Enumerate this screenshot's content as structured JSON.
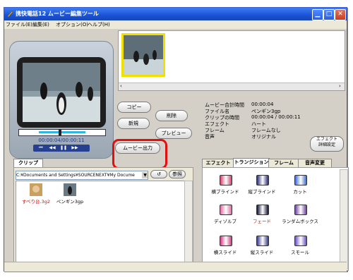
{
  "window": {
    "title": "携快電話12 ムービー編集ツール"
  },
  "menu": [
    "ファイル(E)",
    "編集(E)",
    "オプション(O)",
    "ヘルプ(H)"
  ],
  "player": {
    "time": "00:00:04/00:00:11"
  },
  "buttons": {
    "copy": "コピー",
    "delete": "削除",
    "new": "新規",
    "preview": "プレビュー",
    "movie_out": "ムービー出力",
    "effect_settings_line1": "エフェクト",
    "effect_settings_line2": "詳細設定",
    "browse": "参照"
  },
  "info": [
    {
      "label": "ムービー合計時間",
      "value": "00:00:04"
    },
    {
      "label": "ファイル名",
      "value": "ペンギン3gp"
    },
    {
      "label": "クリップの時間",
      "value": "00:00:04 / 00:00:11"
    },
    {
      "label": "エフェクト",
      "value": "ハート"
    },
    {
      "label": "フレーム",
      "value": "フレームなし"
    },
    {
      "label": "音声",
      "value": "オリジナル"
    }
  ],
  "clip_tab": "クリップ",
  "path": "C:¥Documents and Settings¥SOURCENEXT¥My Docume",
  "clips": [
    {
      "name": "すべり台.3g2",
      "color": "#d01010"
    },
    {
      "name": "ペンギン3gp",
      "color": "#000000"
    }
  ],
  "effect_tabs": [
    "エフェクト",
    "トランジション",
    "フレーム",
    "音声変更"
  ],
  "effect_active_tab": 1,
  "effects": [
    {
      "label": "横ブラインド",
      "color": "#000000"
    },
    {
      "label": "縦ブラインド",
      "color": "#000000"
    },
    {
      "label": "カット",
      "color": "#000000"
    },
    {
      "label": "ディゾルブ",
      "color": "#000000"
    },
    {
      "label": "フェード",
      "color": "#d01010"
    },
    {
      "label": "ランダムボックス",
      "color": "#000000"
    },
    {
      "label": "横スライド",
      "color": "#000000"
    },
    {
      "label": "縦スライド",
      "color": "#000000"
    },
    {
      "label": "スモール",
      "color": "#000000"
    }
  ],
  "colors": {
    "highlight_ring": "#e01010",
    "thumb_border": "#f0e000",
    "title_bar": "#1a52d6"
  }
}
